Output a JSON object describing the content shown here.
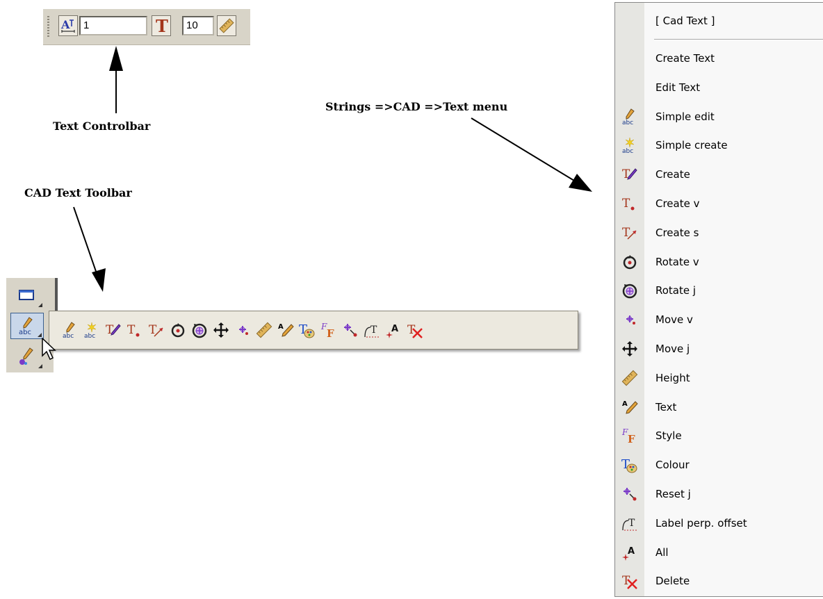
{
  "labels": {
    "controlbar": "Text Controlbar",
    "menu_path": "Strings =>CAD =>Text   menu",
    "toolbar": "CAD Text Toolbar"
  },
  "controlbar": {
    "field1_value": "1",
    "field2_value": "10",
    "buttons": [
      "text-align-icon",
      "text-font-icon",
      "height-ruler-icon"
    ]
  },
  "left_strip": {
    "buttons": [
      "rectangle-tool-icon",
      "pencil-abc-icon",
      "pencil-paint-icon"
    ]
  },
  "flyout_tools": [
    {
      "name": "simple-edit-icon",
      "glyph": "abc-pencil"
    },
    {
      "name": "simple-create-icon",
      "glyph": "abc-star"
    },
    {
      "name": "create-icon",
      "glyph": "T-brush"
    },
    {
      "name": "create-v-icon",
      "glyph": "T-dot"
    },
    {
      "name": "create-s-icon",
      "glyph": "T-arrow"
    },
    {
      "name": "rotate-v-icon",
      "glyph": "rotate"
    },
    {
      "name": "rotate-j-icon",
      "glyph": "rotate-target"
    },
    {
      "name": "move-j-icon",
      "glyph": "move-cross"
    },
    {
      "name": "move-v-icon",
      "glyph": "move-small"
    },
    {
      "name": "height-icon",
      "glyph": "ruler"
    },
    {
      "name": "text-icon",
      "glyph": "A-pencil"
    },
    {
      "name": "colour-icon",
      "glyph": "T-palette"
    },
    {
      "name": "style-icon",
      "glyph": "F-style"
    },
    {
      "name": "reset-j-icon",
      "glyph": "reset"
    },
    {
      "name": "label-perp-offset-icon",
      "glyph": "T-curve"
    },
    {
      "name": "all-icon",
      "glyph": "A-star"
    },
    {
      "name": "delete-icon",
      "glyph": "T-x"
    }
  ],
  "menu": {
    "header": "[ Cad Text ]",
    "items": [
      {
        "label": "Create Text",
        "icon": ""
      },
      {
        "label": "Edit Text",
        "icon": ""
      },
      {
        "label": "Simple edit",
        "icon": "abc-pencil"
      },
      {
        "label": "Simple create",
        "icon": "abc-star"
      },
      {
        "label": "Create",
        "icon": "T-brush"
      },
      {
        "label": "Create v",
        "icon": "T-dot"
      },
      {
        "label": "Create s",
        "icon": "T-arrow"
      },
      {
        "label": "Rotate v",
        "icon": "rotate"
      },
      {
        "label": "Rotate j",
        "icon": "rotate-target"
      },
      {
        "label": "Move v",
        "icon": "move-small"
      },
      {
        "label": "Move j",
        "icon": "move-cross"
      },
      {
        "label": "Height",
        "icon": "ruler"
      },
      {
        "label": "Text",
        "icon": "A-pencil"
      },
      {
        "label": "Style",
        "icon": "F-style"
      },
      {
        "label": "Colour",
        "icon": "T-palette"
      },
      {
        "label": "Reset j",
        "icon": "reset"
      },
      {
        "label": "Label perp. offset",
        "icon": "T-curve"
      },
      {
        "label": "All",
        "icon": "A-star"
      },
      {
        "label": "Delete",
        "icon": "T-x"
      }
    ]
  }
}
